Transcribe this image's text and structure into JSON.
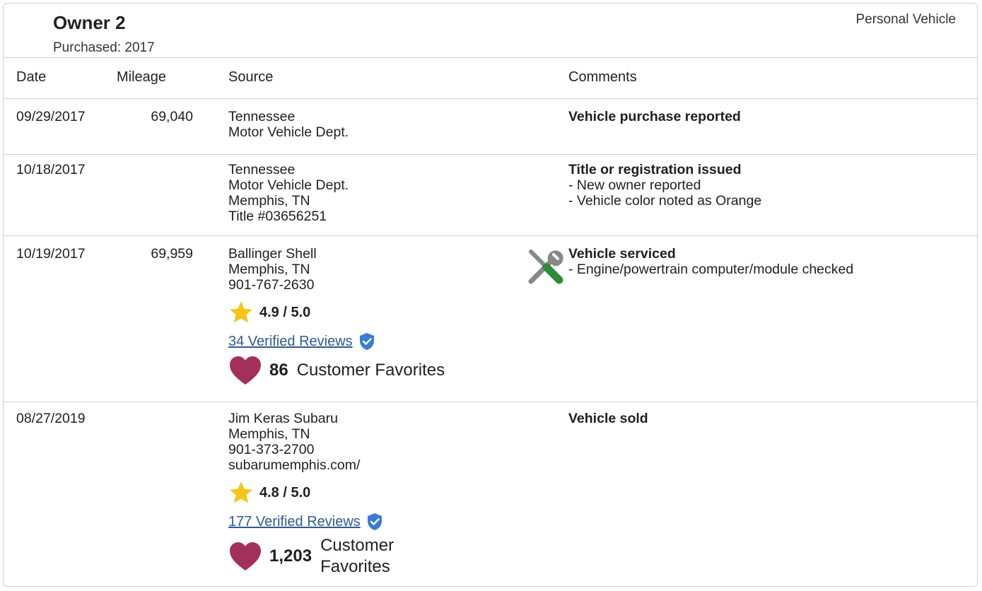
{
  "owner": {
    "title": "Owner 2",
    "purchased": "Purchased: 2017",
    "vehicle_type": "Personal Vehicle"
  },
  "columns": {
    "date": "Date",
    "mileage": "Mileage",
    "source": "Source",
    "comments": "Comments"
  },
  "rows": [
    {
      "date": "09/29/2017",
      "mileage": "69,040",
      "source": [
        "Tennessee",
        "Motor Vehicle Dept."
      ],
      "comment_title": "Vehicle purchase reported",
      "comment_lines": []
    },
    {
      "date": "10/18/2017",
      "mileage": "",
      "source": [
        "Tennessee",
        "Motor Vehicle Dept.",
        "Memphis, TN",
        "Title #03656251"
      ],
      "comment_title": "Title or registration issued",
      "comment_lines": [
        "- New owner reported",
        "- Vehicle color noted as Orange"
      ]
    },
    {
      "date": "10/19/2017",
      "mileage": "69,959",
      "source": [
        "Ballinger Shell",
        "Memphis, TN",
        "901-767-2630"
      ],
      "rating": "4.9 / 5.0",
      "reviews": "34 Verified Reviews",
      "favorites_count": "86",
      "favorites_label": "Customer Favorites",
      "comment_title": "Vehicle serviced",
      "comment_lines": [
        "- Engine/powertrain computer/module checked"
      ],
      "icon": "service-wrench-screwdriver-icon"
    },
    {
      "date": "08/27/2019",
      "mileage": "",
      "source": [
        "Jim Keras Subaru",
        "Memphis, TN",
        "901-373-2700",
        "subarumemphis.com/"
      ],
      "rating": "4.8 / 5.0",
      "reviews": "177 Verified Reviews",
      "favorites_count": "1,203",
      "favorites_label_lines": [
        "Customer",
        "Favorites"
      ],
      "comment_title": "Vehicle sold",
      "comment_lines": []
    }
  ],
  "colors": {
    "border": "#cfcfcf",
    "link": "#2e5b8f",
    "star": "#f5c518",
    "heart": "#a3305a",
    "shield": "#3a7bd5",
    "tool_green": "#2e8b3a",
    "tool_gray": "#888888"
  }
}
